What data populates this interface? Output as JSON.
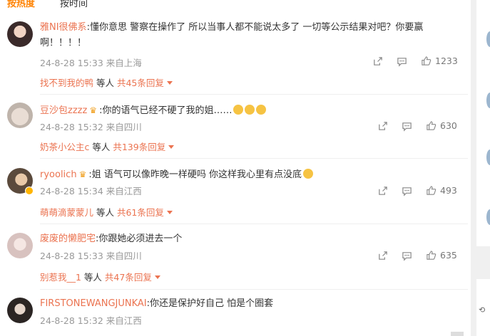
{
  "sort_tabs": {
    "hot": "按热度",
    "time": "按时间"
  },
  "comments": [
    {
      "username": "雅NI很佛系",
      "content": ":懂你意思 警察在操作了 所以当事人都不能说太多了 一切等公示结果对吧？你要赢啊！！！！",
      "time": "24-8-28 15:33",
      "location": "来自上海",
      "likes": "1233",
      "reply_users": "找不到我的鸭",
      "reply_suffix": " 等人",
      "reply_total": "共45条回复"
    },
    {
      "username": "豆沙包zzzz",
      "content": ":你的语气已经不硬了我的姐……",
      "time": "24-8-28 15:32",
      "location": "来自四川",
      "likes": "630",
      "reply_users": "奶茶小公主c",
      "reply_suffix": " 等人",
      "reply_total": "共139条回复"
    },
    {
      "username": "ryoolich",
      "content": ":姐 语气可以像昨晚一样硬吗 你这样我心里有点没底",
      "time": "24-8-28 15:34",
      "location": "来自江西",
      "likes": "493",
      "reply_users": "萌萌滴蒙蒙儿",
      "reply_suffix": " 等人",
      "reply_total": "共61条回复"
    },
    {
      "username": "废废的懒肥宅",
      "content": ":你跟她必须进去一个",
      "time": "24-8-28 15:33",
      "location": "来自四川",
      "likes": "635",
      "reply_users": "别惹我__1",
      "reply_suffix": " 等人",
      "reply_total": "共47条回复"
    },
    {
      "username": "FIRSTONEWANGJUNKAI",
      "content": ":你还是保护好自己 怕是个圈套",
      "time": "24-8-28 15:32",
      "location": "来自江西"
    }
  ],
  "icons": {
    "share": "share-icon",
    "comment": "comment-icon",
    "like": "thumbs-up-icon"
  },
  "colors": {
    "accent": "#ff8200",
    "username": "#eb7350",
    "meta": "#999999"
  }
}
